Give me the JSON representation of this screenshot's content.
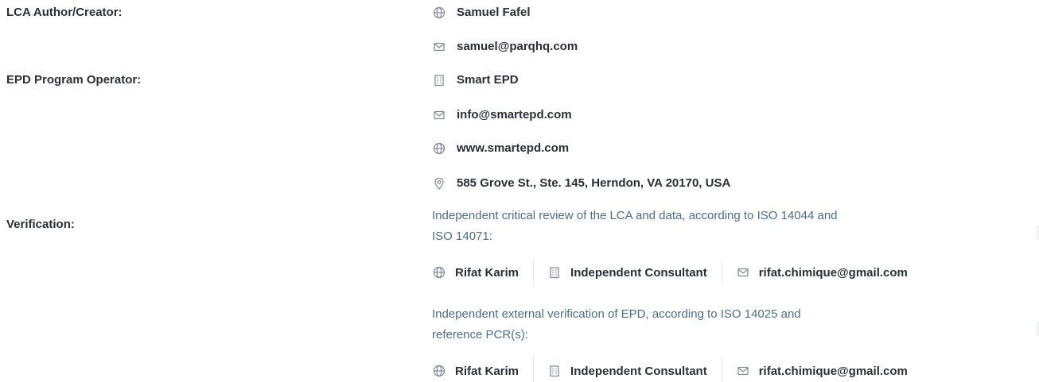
{
  "lca_author": {
    "label": "LCA Author/Creator:",
    "name": "Samuel Fafel",
    "email": "samuel@parqhq.com"
  },
  "program_operator": {
    "label": "EPD Program Operator:",
    "organization": "Smart EPD",
    "email": "info@smartepd.com",
    "website": "www.smartepd.com",
    "address": "585 Grove St., Ste. 145, Herndon, VA 20170, USA"
  },
  "verification": {
    "label": "Verification:",
    "reviews": [
      {
        "description_line1": "Independent critical review of the LCA and data, according to ISO 14044 and",
        "description_line2": "ISO 14071:",
        "person": "Rifat Karim",
        "organization": "Independent Consultant",
        "email": "rifat.chimique@gmail.com"
      },
      {
        "description_line1": "Independent external verification of EPD, according to ISO 14025 and",
        "description_line2": "reference PCR(s):",
        "person": "Rifat Karim",
        "organization": "Independent Consultant",
        "email": "rifat.chimique@gmail.com"
      }
    ]
  },
  "icons": {
    "globe": "globe-icon",
    "mail": "mail-icon",
    "building": "building-icon",
    "location": "location-pin-icon"
  },
  "colors": {
    "text": "#2b2f36",
    "note": "#4f6d84",
    "icon": "#7d8793",
    "divider": "#e4e7ea"
  }
}
